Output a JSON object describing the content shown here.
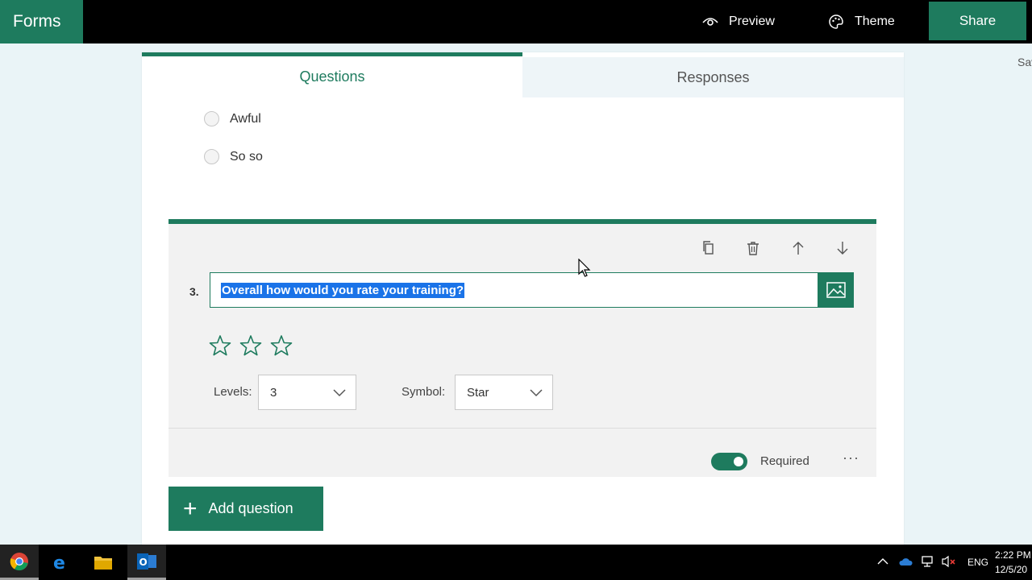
{
  "topbar": {
    "brand": "Forms",
    "preview_label": "Preview",
    "theme_label": "Theme",
    "share_label": "Share",
    "saved_label": "Sav"
  },
  "tabs": [
    {
      "label": "Questions",
      "active": true
    },
    {
      "label": "Responses",
      "active": false
    }
  ],
  "previous_choices": [
    "Awful",
    "So so"
  ],
  "question": {
    "number": "3.",
    "text": "Overall how would you rate your training?",
    "star_count": 3,
    "levels_label": "Levels:",
    "levels_value": "3",
    "symbol_label": "Symbol:",
    "symbol_value": "Star",
    "required_label": "Required",
    "required_on": true,
    "more_label": "···"
  },
  "add_question_label": "Add question",
  "taskbar": {
    "apps": [
      "chrome-icon",
      "edge-icon",
      "file-explorer-icon",
      "outlook-icon"
    ],
    "language": "ENG",
    "time": "2:22 PM",
    "date": "12/5/20"
  },
  "colors": {
    "accent": "#1e7b5e",
    "selection": "#1a73e8",
    "background": "#eaf4f7"
  }
}
